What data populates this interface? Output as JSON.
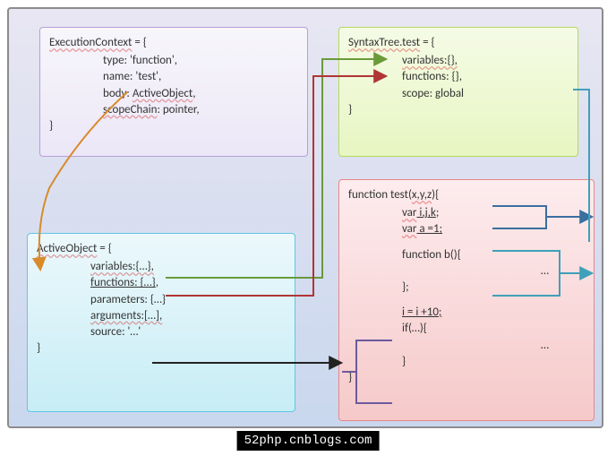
{
  "ec": {
    "title": "ExecutionContext",
    "eq": " = {",
    "type": "type: 'function',",
    "name": "name: 'test',",
    "body_l": "body:",
    "body_r": "ActiveObject",
    "body_c": ",",
    "scope": "scopeChain",
    "scope2": ": pointer,",
    "close": "}"
  },
  "st": {
    "title": "SyntaxTree.test",
    "eq": " = {",
    "vars": "variables:{},",
    "funcs": "functions: {},",
    "scope": "scope: global",
    "close": "}"
  },
  "ao": {
    "title": "ActiveObject",
    "eq": " = {",
    "vars": "variables:{…},",
    "funcs": "functions: {…}",
    "funcs_c": ",",
    "params": "parameters: {…}",
    "args": "arguments:[…],",
    "src": "source: '…'",
    "close": "}"
  },
  "fn": {
    "sig": "function test(",
    "params": "x,y,z",
    "sig2": "){",
    "var1": "var",
    "var1b": " i,j,k",
    "var1c": ";",
    "var2": "var",
    "var2b": " a =1;",
    "fb": "function b(){",
    "dots": "…",
    "fbc": "};",
    "iexpr": "i = i +10;",
    "ifexp": "if(…){",
    "ifc": "}",
    "close": "}"
  },
  "footer": "52php.cnblogs.com"
}
